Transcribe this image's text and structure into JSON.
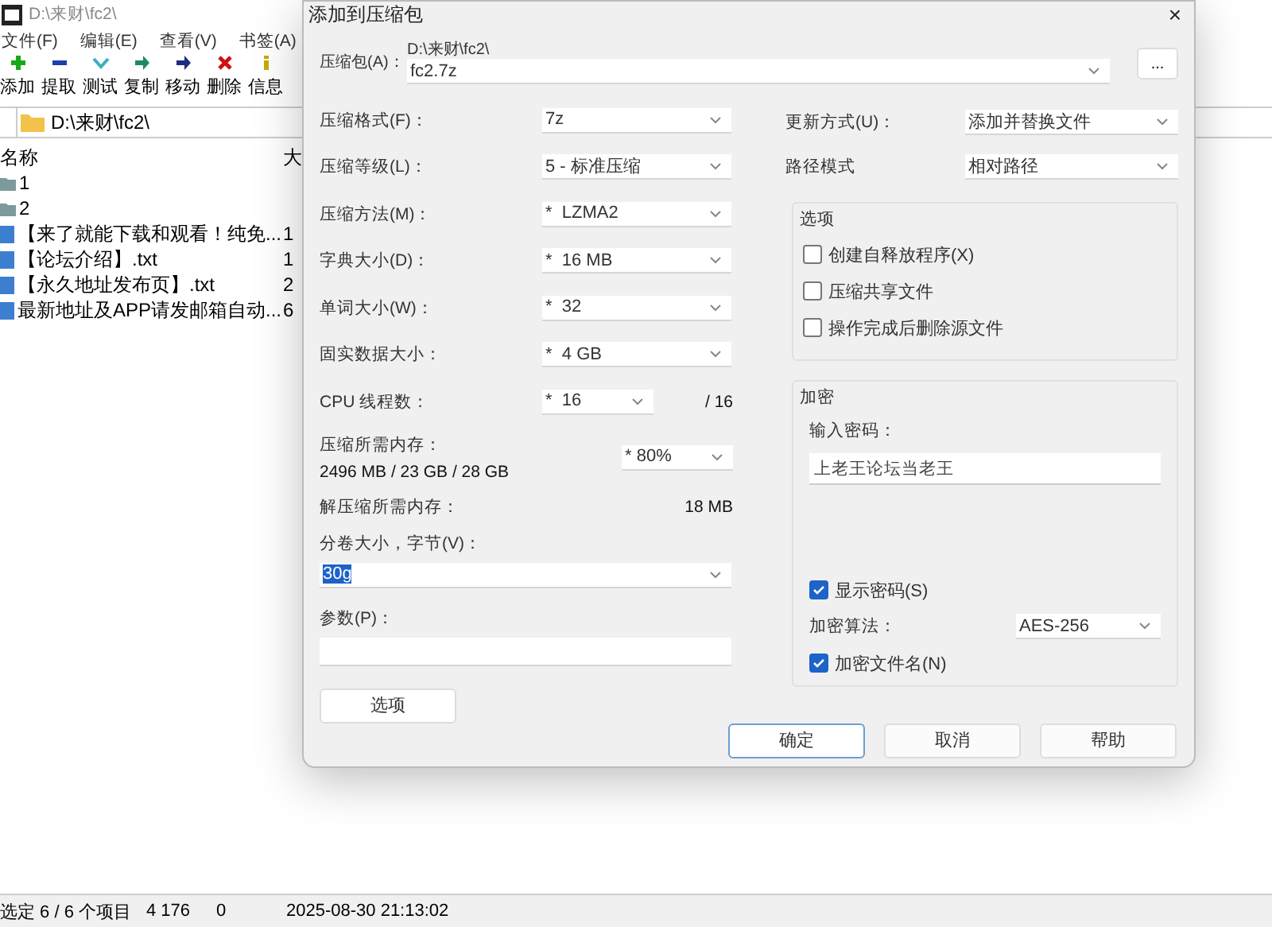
{
  "window": {
    "title": "D:\\来财\\fc2\\",
    "menu": [
      "文件(F)",
      "编辑(E)",
      "查看(V)",
      "书签(A)"
    ],
    "toolbar": [
      {
        "label": "添加",
        "kind": "add"
      },
      {
        "label": "提取",
        "kind": "extract"
      },
      {
        "label": "测试",
        "kind": "test"
      },
      {
        "label": "复制",
        "kind": "copy"
      },
      {
        "label": "移动",
        "kind": "move"
      },
      {
        "label": "删除",
        "kind": "delete"
      },
      {
        "label": "信息",
        "kind": "info"
      }
    ],
    "address": "D:\\来财\\fc2\\",
    "columns": [
      "名称",
      "大"
    ],
    "rows": [
      {
        "name": "1",
        "kind": "folder"
      },
      {
        "name": "2",
        "kind": "folder"
      },
      {
        "name": "【来了就能下载和观看！纯免...",
        "kind": "file",
        "size": "1"
      },
      {
        "name": "【论坛介绍】.txt",
        "kind": "file",
        "size": "1"
      },
      {
        "name": "【永久地址发布页】.txt",
        "kind": "file",
        "size": "2"
      },
      {
        "name": "最新地址及APP请发邮箱自动...",
        "kind": "file",
        "size": "6"
      }
    ],
    "status_bar": [
      "选定 6 / 6 个项目",
      "4 176",
      "0",
      "2025-08-30 21:13:02"
    ]
  },
  "dialog": {
    "title": "添加到压缩包",
    "close": "×",
    "archive_label": "压缩包(A)：",
    "archive_path": "D:\\来财\\fc2\\",
    "archive_name": "fc2.7z",
    "browse": "...",
    "settings": [
      {
        "label": "压缩格式(F)：",
        "value": "7z"
      },
      {
        "label": "压缩等级(L)：",
        "value": "5 - 标准压缩"
      },
      {
        "label": "压缩方法(M)：",
        "value": "*  LZMA2"
      },
      {
        "label": "字典大小(D)：",
        "value": "*  16 MB"
      },
      {
        "label": "单词大小(W)：",
        "value": "*  32"
      },
      {
        "label": "固实数据大小：",
        "value": "*  4 GB"
      }
    ],
    "cpu": {
      "label": "CPU 线程数：",
      "value": "*  16",
      "max": "/ 16"
    },
    "memory": {
      "label": "压缩所需内存：",
      "value": "2496 MB / 23 GB / 28 GB",
      "percent": "* 80%"
    },
    "decompress": {
      "label": "解压缩所需内存：",
      "value": "18 MB"
    },
    "split": {
      "label": "分卷大小，字节(V)：",
      "value": "30g",
      "highlighted": true
    },
    "params": {
      "label": "参数(P)："
    },
    "options_button": "选项",
    "update": {
      "label": "更新方式(U)：",
      "value": "添加并替换文件"
    },
    "path_mode": {
      "label": "路径模式",
      "value": "相对路径"
    },
    "options": {
      "title": "选项",
      "items": [
        {
          "label": "创建自释放程序(X)",
          "checked": false
        },
        {
          "label": "压缩共享文件",
          "checked": false
        },
        {
          "label": "操作完成后删除源文件",
          "checked": false
        }
      ]
    },
    "encryption": {
      "title": "加密",
      "password_label": "输入密码：",
      "password": "上老王论坛当老王",
      "show_password": {
        "label": "显示密码(S)",
        "checked": true
      },
      "method_label": "加密算法：",
      "method": "AES-256",
      "encrypt_names": {
        "label": "加密文件名(N)",
        "checked": true
      }
    },
    "buttons": [
      {
        "label": "确定",
        "default": true
      },
      {
        "label": "取消",
        "default": false
      },
      {
        "label": "帮助",
        "default": false
      }
    ]
  }
}
